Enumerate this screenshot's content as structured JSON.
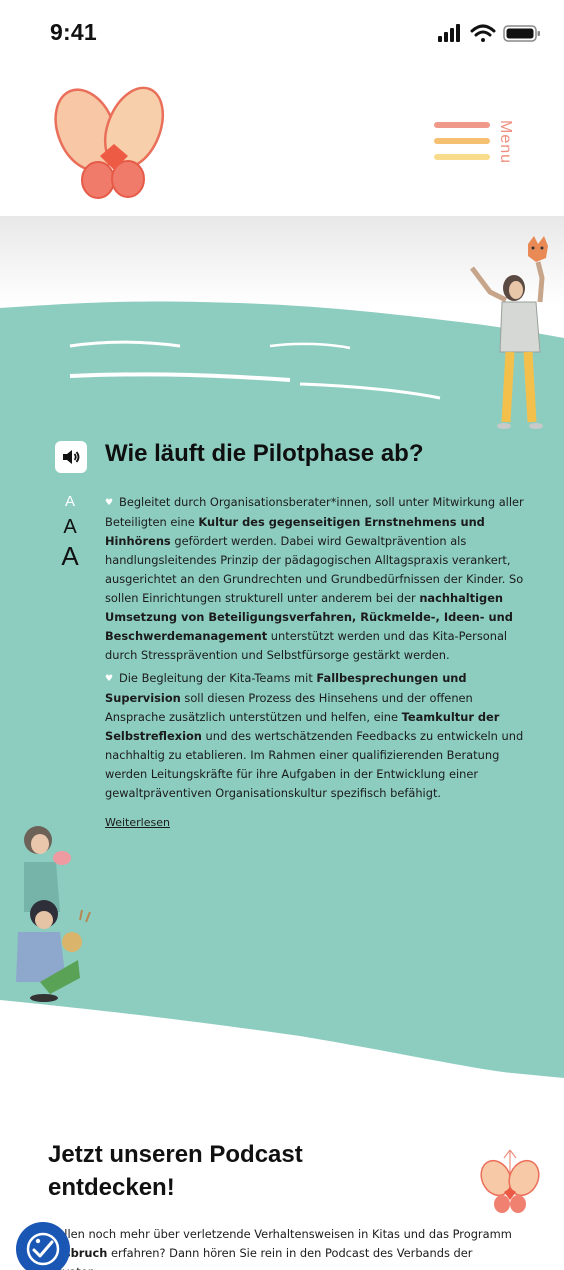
{
  "status_bar": {
    "time": "9:41"
  },
  "header": {
    "menu_label": "Menu",
    "menu_colors": [
      "#ec7f6d",
      "#f2b04d",
      "#f6d36e"
    ]
  },
  "colors": {
    "teal": "#8dcdc0",
    "white": "#ffffff",
    "accessibility_blue": "#1a57b5"
  },
  "section": {
    "title": "Wie läuft die Pilotphase ab?",
    "font_size_labels": [
      "A",
      "A",
      "A"
    ],
    "paragraph1": {
      "t1": "Begleitet durch Organisationsberater*innen, soll unter Mitwirkung aller Beteiligten eine ",
      "b1": "Kultur des gegenseitigen Ernstnehmens und Hinhörens",
      "t2": " gefördert werden. Dabei wird Gewaltprävention als handlungsleitendes Prinzip der pädagogischen Alltagspraxis verankert, ausgerichtet an den Grundrechten und Grundbedürfnissen der Kinder. So sollen Einrichtungen strukturell unter anderem bei der ",
      "b2": "nachhaltigen Umsetzung von Beteiligungsverfahren, Rückmelde-, Ideen- und Beschwerdemanagement",
      "t3": " unterstützt werden und das Kita-Personal durch Stressprävention und Selbstfürsorge gestärkt werden."
    },
    "paragraph2": {
      "t1": "Die Begleitung der Kita-Teams mit ",
      "b1": "Fallbesprechungen und Supervision",
      "t2": " soll diesen Prozess des Hinsehens und der offenen Ansprache zusätzlich unterstützen und helfen, eine ",
      "b2": "Teamkultur der Selbstreflexion",
      "t3": " und des wertschätzenden Feedbacks zu entwickeln und nachhaltig zu etablieren. Im Rahmen einer qualifizierenden Beratung werden Leitungskräfte für ihre Aufgaben in der Entwicklung einer gewaltpräventiven Organisationskultur spezifisch befähigt."
    },
    "read_more": "Weiterlesen"
  },
  "podcast": {
    "title": "Jetzt unseren Podcast entdecken!",
    "t1": "wollen noch mehr über verletzende Verhaltensweisen in Kitas und das Programm ",
    "b1": "ausbruch",
    "t2": " erfahren? Dann hören Sie rein in den Podcast des Verbands der Privaten"
  },
  "icons": [
    "signal-icon",
    "wifi-icon",
    "battery-icon",
    "butterfly-logo",
    "speaker-icon",
    "heart-bullet-icon",
    "accessibility-icon"
  ]
}
